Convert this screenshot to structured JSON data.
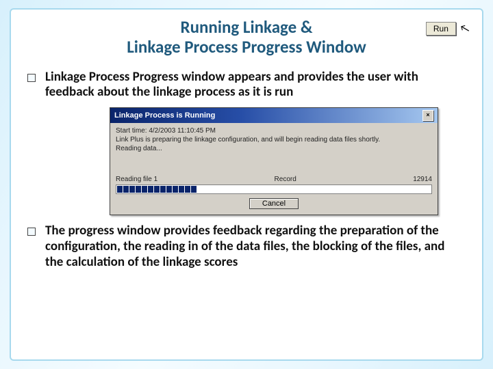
{
  "title": {
    "line1": "Running Linkage &",
    "line2": "Linkage Process Progress Window"
  },
  "run_button": {
    "label": "Run"
  },
  "bullets": {
    "b1": "Linkage Process Progress window appears and provides the user with feedback about the linkage process as it is run",
    "b2": "The progress window provides feedback regarding the preparation of the configuration, the reading in of the data files, the blocking of the files, and the calculation of the linkage scores"
  },
  "dialog": {
    "title": "Linkage Process is Running",
    "line1": "Start time: 4/2/2003  11:10:45 PM",
    "line2": "Link Plus is preparing the linkage configuration, and will begin reading data files shortly.",
    "line3": "Reading data...",
    "reading_label": "Reading file 1",
    "record_label": "Record",
    "record_value": "12914",
    "cancel": "Cancel"
  }
}
